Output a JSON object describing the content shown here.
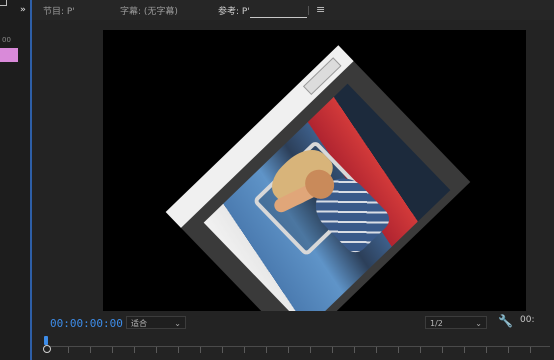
{
  "left_panel": {
    "expand_icon": "»",
    "time_fragment": "00"
  },
  "tabs": [
    {
      "label": "节目: P'"
    },
    {
      "label": "字幕: (无字幕)"
    },
    {
      "label": "参考: P'"
    }
  ],
  "menu_icon": "≡",
  "controls": {
    "timecode": "00:00:00:00",
    "fit_select": "适合",
    "resolution_select": "1/2",
    "wrench_icon": "🔧",
    "extra": "00:"
  },
  "colors": {
    "accent_blue": "#3d8ce8",
    "clip_pink": "#d98ad9",
    "background": "#232323"
  }
}
